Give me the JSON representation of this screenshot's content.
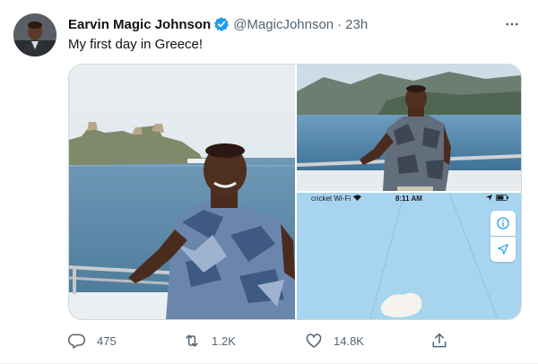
{
  "tweet": {
    "name": "Earvin Magic Johnson",
    "handle": "@MagicJohnson",
    "separator": "·",
    "time": "23h",
    "text": "My first day in Greece!"
  },
  "map_screenshot": {
    "carrier": "cricket Wi-Fi",
    "clock": "8:11 AM"
  },
  "actions": {
    "replies": "475",
    "retweets": "1.2K",
    "likes": "14.8K"
  },
  "icons": {
    "avatar": "avatar-icon",
    "verified": "verified-badge-icon",
    "more": "more-options-icon",
    "reply": "reply-icon",
    "retweet": "retweet-icon",
    "like": "heart-icon",
    "share": "share-icon",
    "info": "info-icon",
    "location": "location-arrow-icon",
    "wifi": "wifi-icon",
    "battery": "battery-icon"
  },
  "colors": {
    "brand": "#1d9bf0",
    "text_primary": "#0f1419",
    "text_secondary": "#536471",
    "border": "#cfd9de"
  }
}
